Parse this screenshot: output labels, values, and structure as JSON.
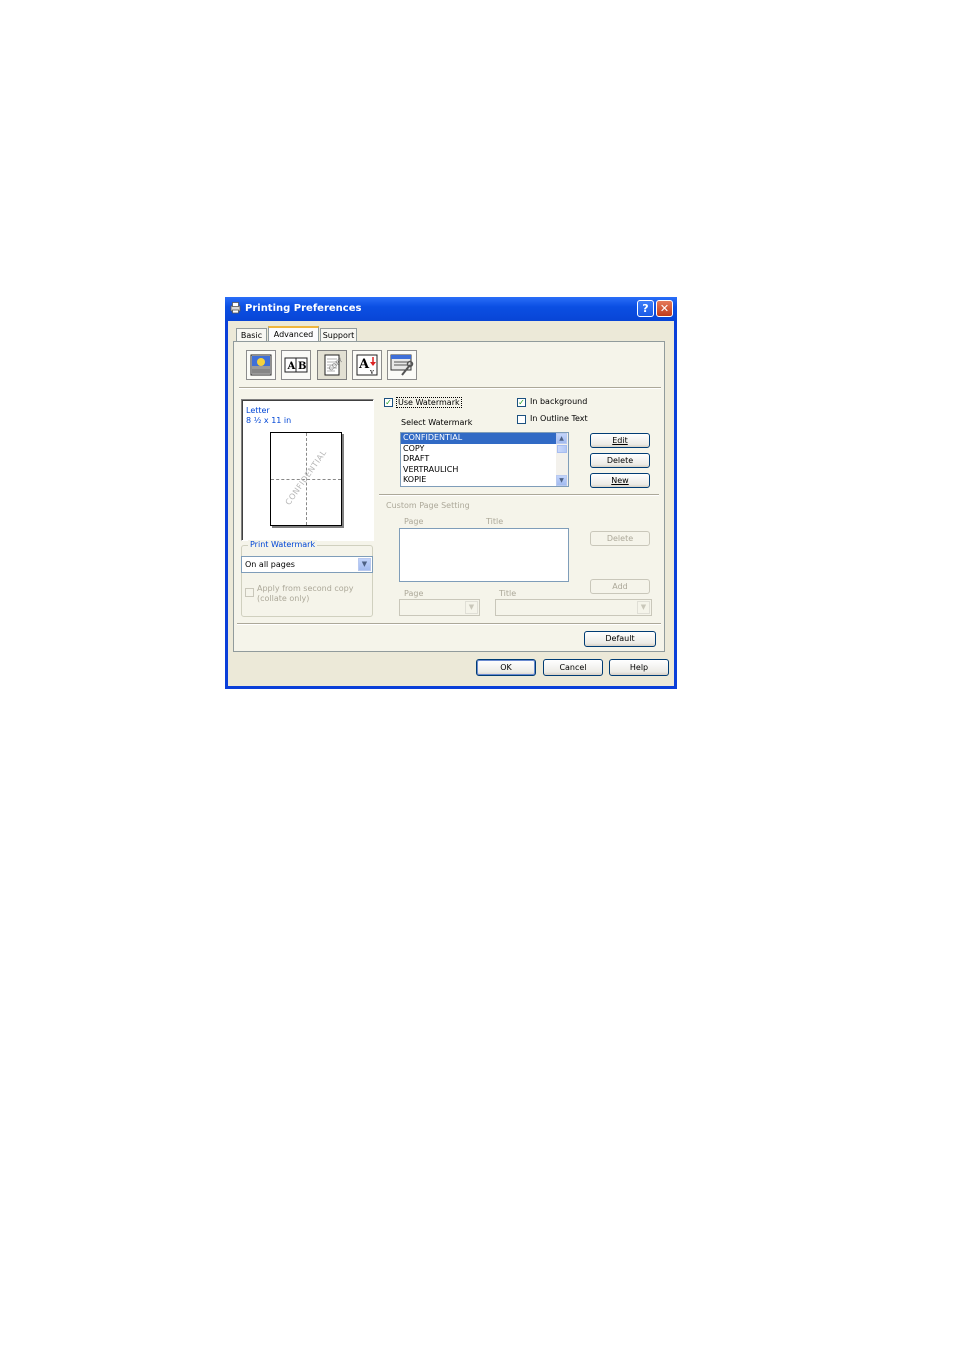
{
  "window": {
    "title": "Printing Preferences",
    "help_glyph": "?",
    "close_glyph": "✕"
  },
  "tabs": [
    {
      "label": "Basic"
    },
    {
      "label": "Advanced"
    },
    {
      "label": "Support"
    }
  ],
  "toolbar_icons": [
    "print-quality-icon",
    "duplex-icon",
    "watermark-icon",
    "page-setting-icon",
    "device-options-icon"
  ],
  "preview": {
    "paper": "Letter",
    "size": "8 ½ x 11 in",
    "watermark_text": "CONFIDENTIAL"
  },
  "print_watermark": {
    "group_label": "Print Watermark",
    "selected": "On all pages",
    "apply_label_line1": "Apply from second copy",
    "apply_label_line2": "(collate only)"
  },
  "watermark": {
    "use_label": "Use Watermark",
    "use_checked": true,
    "in_background_label": "In background",
    "in_background_checked": true,
    "in_outline_label": "In Outline Text",
    "in_outline_checked": false,
    "select_label": "Select Watermark",
    "items": [
      "CONFIDENTIAL",
      "COPY",
      "DRAFT",
      "VERTRAULICH",
      "KOPIE"
    ],
    "selected_index": 0,
    "edit_label": "Edit",
    "delete_label": "Delete",
    "new_label": "New"
  },
  "custom_page": {
    "group_label": "Custom Page Setting",
    "page_header": "Page",
    "title_header": "Title",
    "delete_label": "Delete",
    "add_label": "Add",
    "page_label": "Page",
    "title_label": "Title"
  },
  "footer": {
    "default_label": "Default",
    "ok_label": "OK",
    "cancel_label": "Cancel",
    "help_label": "Help"
  },
  "check_glyph": "✓",
  "arrow_down": "▼",
  "arrow_up": "▲"
}
